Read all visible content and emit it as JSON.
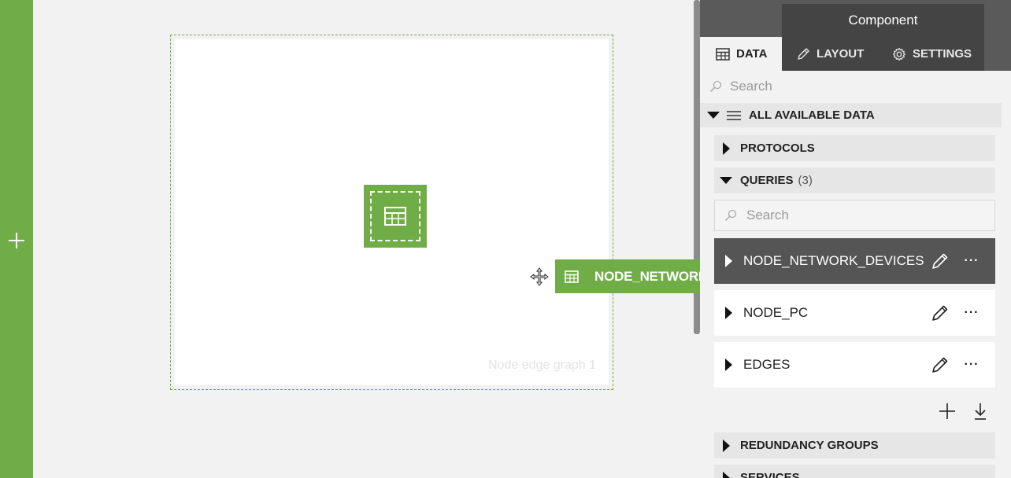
{
  "canvas": {
    "component_caption": "Node edge graph 1"
  },
  "drag": {
    "label": "NODE_NETWORK_DEVICES"
  },
  "panel": {
    "title": "Component",
    "tabs": [
      {
        "label": "DATA",
        "icon": "table-icon",
        "active": true
      },
      {
        "label": "LAYOUT",
        "icon": "pen-icon",
        "active": false
      },
      {
        "label": "SETTINGS",
        "icon": "gear-icon",
        "active": false
      }
    ],
    "search_placeholder": "Search",
    "all_data_label": "ALL AVAILABLE DATA",
    "sections": {
      "protocols": {
        "label": "PROTOCOLS"
      },
      "queries": {
        "label": "QUERIES",
        "count": "(3)",
        "search_placeholder": "Search",
        "items": [
          {
            "label": "NODE_NETWORK_DEVICES",
            "selected": true
          },
          {
            "label": "NODE_PC",
            "selected": false
          },
          {
            "label": "EDGES",
            "selected": false
          }
        ]
      },
      "redundancy": {
        "label": "REDUNDANCY GROUPS"
      },
      "services": {
        "label": "SERVICES"
      }
    },
    "more_glyph": "···"
  },
  "colors": {
    "accent": "#70ad47",
    "panel_header": "#5a5a5a",
    "selected_row": "#555555"
  }
}
